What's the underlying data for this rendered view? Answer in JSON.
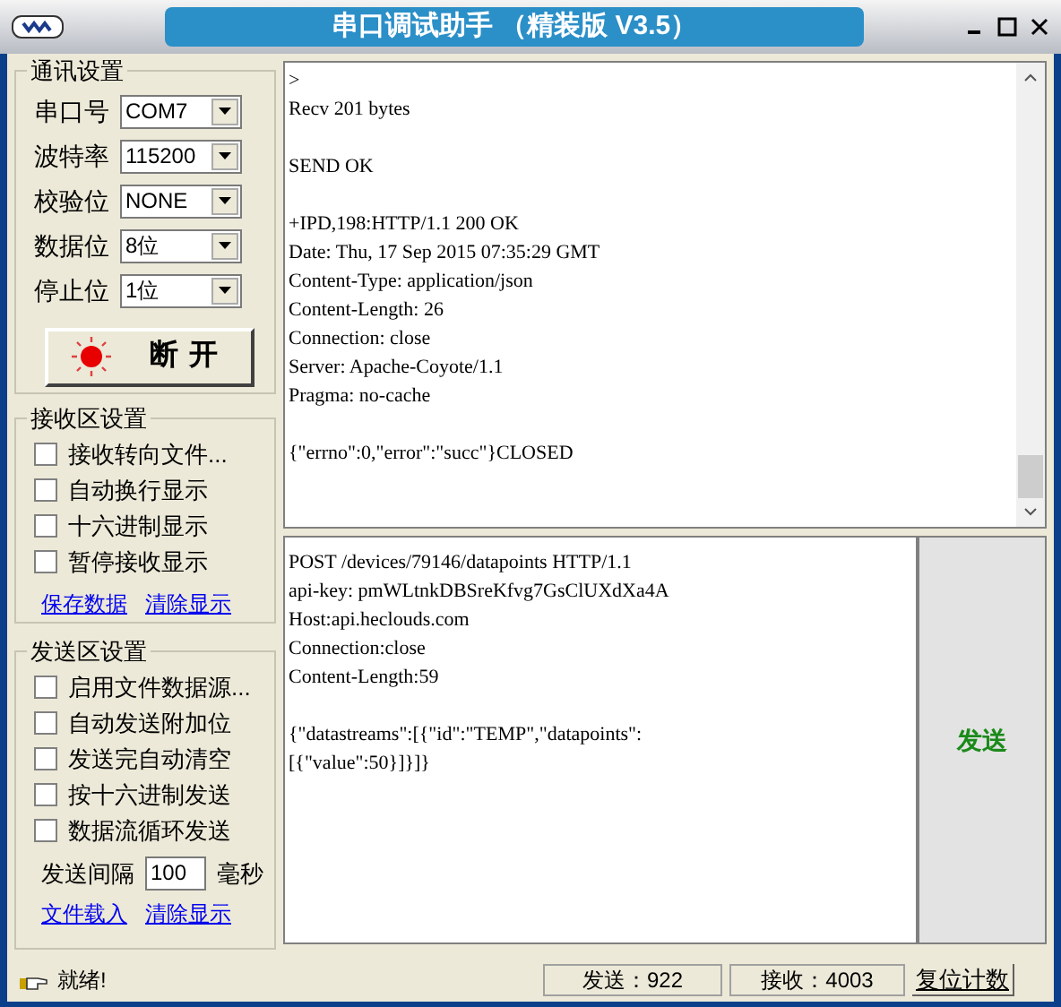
{
  "window": {
    "title": "串口调试助手 （精装版 V3.5）"
  },
  "comm_settings": {
    "title": "通讯设置",
    "fields": [
      {
        "label": "串口号",
        "value": "COM7"
      },
      {
        "label": "波特率",
        "value": "115200"
      },
      {
        "label": "校验位",
        "value": "NONE"
      },
      {
        "label": "数据位",
        "value": "8位"
      },
      {
        "label": "停止位",
        "value": "1位"
      }
    ],
    "connect_button": {
      "label": "断开",
      "connected": true
    }
  },
  "receive_settings": {
    "title": "接收区设置",
    "options": [
      {
        "label": "接收转向文件...",
        "checked": false
      },
      {
        "label": "自动换行显示",
        "checked": false
      },
      {
        "label": "十六进制显示",
        "checked": false
      },
      {
        "label": "暂停接收显示",
        "checked": false
      }
    ],
    "links": [
      "保存数据",
      "清除显示"
    ]
  },
  "send_settings": {
    "title": "发送区设置",
    "options": [
      {
        "label": "启用文件数据源...",
        "checked": false
      },
      {
        "label": "自动发送附加位",
        "checked": false
      },
      {
        "label": "发送完自动清空",
        "checked": false
      },
      {
        "label": "按十六进制发送",
        "checked": false
      },
      {
        "label": "数据流循环发送",
        "checked": false
      }
    ],
    "interval": {
      "label": "发送间隔",
      "value": "100",
      "unit": "毫秒"
    },
    "links": [
      "文件载入",
      "清除显示"
    ]
  },
  "receive_area": {
    "text": ">\nRecv 201 bytes\n\nSEND OK\n\n+IPD,198:HTTP/1.1 200 OK\nDate: Thu, 17 Sep 2015 07:35:29 GMT\nContent-Type: application/json\nContent-Length: 26\nConnection: close\nServer: Apache-Coyote/1.1\nPragma: no-cache\n\n{\"errno\":0,\"error\":\"succ\"}CLOSED"
  },
  "send_area": {
    "text": "POST /devices/79146/datapoints HTTP/1.1\napi-key: pmWLtnkDBSreKfvg7GsClUXdXa4A\nHost:api.heclouds.com\nConnection:close\nContent-Length:59\n\n{\"datastreams\":[{\"id\":\"TEMP\",\"datapoints\":\n[{\"value\":50}]}]}",
    "send_button": "发送"
  },
  "status_bar": {
    "status": "就绪!",
    "sent": "发送：922",
    "received": "接收：4003",
    "reset_button": "复位计数"
  }
}
